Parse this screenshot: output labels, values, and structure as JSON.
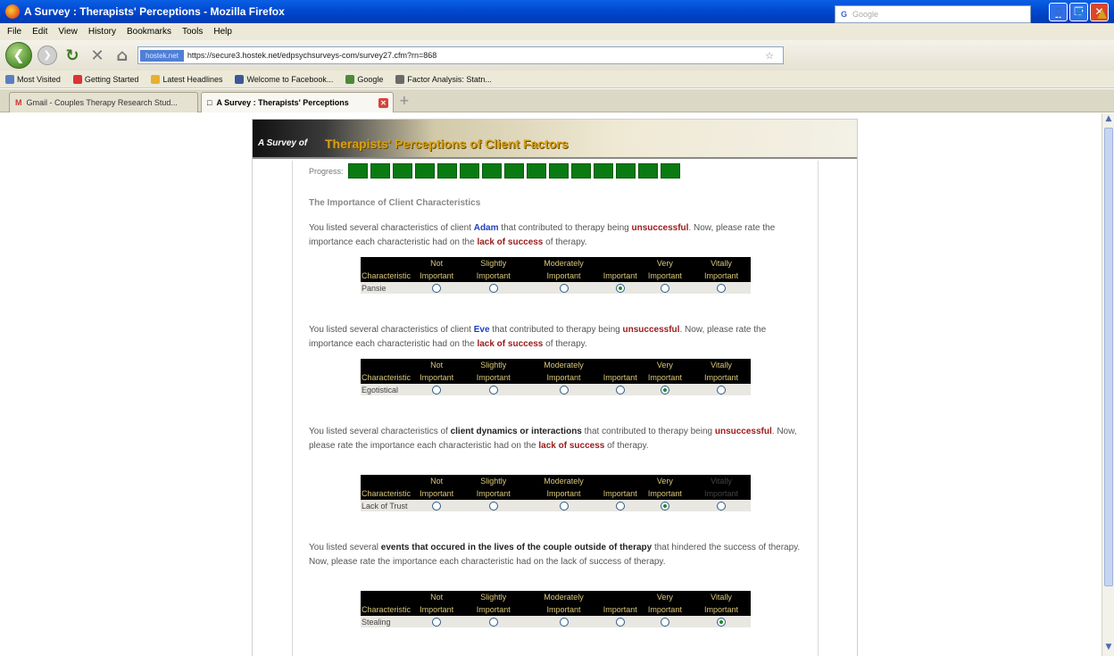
{
  "window": {
    "title": "A Survey : Therapists' Perceptions - Mozilla Firefox",
    "controls": [
      "_",
      "❐",
      "✕"
    ]
  },
  "menu": [
    "File",
    "Edit",
    "View",
    "History",
    "Bookmarks",
    "Tools",
    "Help"
  ],
  "nav": {
    "site_label": "hostek.net",
    "url": "https://secure3.hostek.net/edpsychsurveys-com/survey27.cfm?rn=868",
    "search_placeholder": "Google"
  },
  "bookmarks": [
    "Most Visited",
    "Getting Started",
    "Latest Headlines",
    "Welcome to Facebook...",
    "Google",
    "Factor Analysis: Statn..."
  ],
  "tabs": [
    {
      "label": "Gmail - Couples Therapy Research Stud...",
      "active": false
    },
    {
      "label": "A Survey : Therapists' Perceptions",
      "active": true
    }
  ],
  "page": {
    "banner_small": "A Survey of",
    "banner_title": "Therapists' Perceptions of Client Factors",
    "progress_label": "Progress:",
    "progress_boxes": 15,
    "heading": "The Importance of Client Characteristics",
    "headers": [
      "Characteristic",
      "Not Important",
      "Slightly Important",
      "Moderately Important",
      "Important",
      "Very Important",
      "Vitally Important"
    ],
    "questions": [
      {
        "text_pre": "You listed several characteristics of client ",
        "subject": "Adam",
        "text_mid": " that contributed to therapy being ",
        "outcome": "unsuccessful",
        "text_post": ". Now, please rate the importance each characteristic had on the ",
        "emphasis": "lack of success",
        "text_end": " of therapy.",
        "row_label": "Pansie",
        "selected": 3
      },
      {
        "text_pre": "You listed several characteristics of client ",
        "subject": "Eve",
        "text_mid": " that contributed to therapy being ",
        "outcome": "unsuccessful",
        "text_post": ". Now, please rate the importance each characteristic had on the ",
        "emphasis": "lack of success",
        "text_end": " of therapy.",
        "row_label": "Egotistical",
        "selected": 4
      },
      {
        "text_pre": "You listed several characteristics of ",
        "subject": "client dynamics or interactions",
        "text_mid": " that contributed to therapy being ",
        "outcome": "unsuccessful",
        "text_post": ". Now, please rate the importance each characteristic had on the ",
        "emphasis": "lack of success",
        "text_end": " of therapy.",
        "row_label": "Lack of Trust",
        "selected": 4
      },
      {
        "text_pre": "You listed several ",
        "subject": "events that occured in the lives of the couple outside of therapy",
        "text_mid": " that hindered the success of therapy. Now, please rate the importance each characteristic had on the lack of success of therapy.",
        "row_label": "Stealing",
        "selected": 5
      }
    ]
  }
}
